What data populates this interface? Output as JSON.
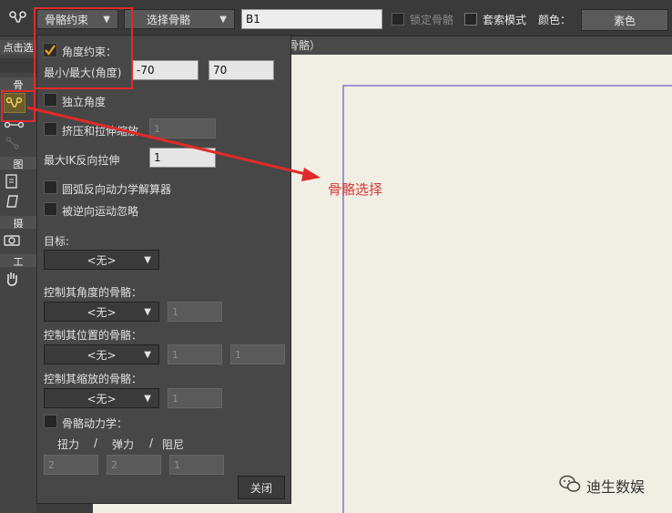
{
  "toolbar": {
    "bone_constraint_dropdown": "骨骼约束",
    "select_bone_dropdown": "选择骨骼",
    "bone_name_value": "B1",
    "lock_bone_label": "锁定骨骼",
    "pixel_mode_label": "套索模式",
    "color_label": "颜色：",
    "color_value": "素色"
  },
  "left_strip": {
    "click_select_label": "点击选",
    "section_bone": "骨",
    "section_shape": "图",
    "section_camera": "摄",
    "section_work": "工"
  },
  "canvas": {
    "tab_title": "骨骼）"
  },
  "panel": {
    "angle_constraint_label": "角度约束：",
    "minmax_label": "最小/最大(角度)",
    "min_value": "-70",
    "max_value": "70",
    "independent_angle_label": "独立角度",
    "squash_stretch_label": "挤压和拉伸缩放",
    "squash_stretch_value": "1",
    "max_ik_label": "最大IK反向拉伸",
    "max_ik_value": "1",
    "arc_ik_label": "圆弧反向动力学解算器",
    "ignore_ik_label": "被逆向运动忽略",
    "target_label": "目标:",
    "target_value": "<无>",
    "angle_ctrl_label": "控制其角度的骨骼：",
    "angle_ctrl_value": "<无>",
    "angle_ctrl_input": "1",
    "pos_ctrl_label": "控制其位置的骨骼：",
    "pos_ctrl_value": "<无>",
    "pos_ctrl_input1": "1",
    "pos_ctrl_input2": "1",
    "scale_ctrl_label": "控制其缩放的骨骼：",
    "scale_ctrl_value": "<无>",
    "scale_ctrl_input": "1",
    "bone_dynamics_label": "骨骼动力学：",
    "torque_label": "扭力",
    "spring_label": "弹力",
    "damping_label": "阻尼",
    "sep": "/",
    "torque_value": "2",
    "spring_value": "2",
    "damping_value": "1",
    "close_button": "关闭"
  },
  "annotation": {
    "text": "骨骼选择"
  },
  "watermark": {
    "text": "迪生数娱"
  },
  "colors": {
    "accent_red": "#e02a2a",
    "panel_bg": "#474747",
    "paper": "#f1efe3",
    "frame": "#9b93cf"
  }
}
